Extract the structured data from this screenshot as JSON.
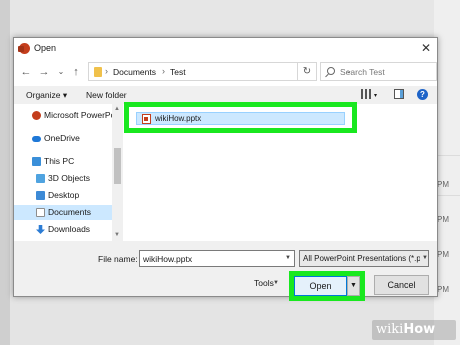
{
  "background": {
    "times": [
      "PM",
      "PM",
      "PM",
      "PM"
    ],
    "watermark": {
      "wiki": "wiki",
      "how": "How"
    }
  },
  "dialog": {
    "title": "Open",
    "close_label": "✕"
  },
  "navigation": {
    "back": "←",
    "forward": "→",
    "dropdown": "⌄",
    "up": "↑",
    "path": [
      "Documents",
      "Test"
    ],
    "separator": "›",
    "refresh": "↻",
    "search_placeholder": "Search Test"
  },
  "command_bar": {
    "organize": "Organize ▾",
    "new_folder": "New folder",
    "view_dd": "▾",
    "help": "?"
  },
  "sidebar": {
    "items": [
      {
        "label": "Microsoft PowerPo",
        "color": "#c43e1c"
      },
      {
        "label": "OneDrive",
        "color": "#1e78d7"
      },
      {
        "label": "This PC",
        "color": "#3a8fd9"
      },
      {
        "label": "3D Objects",
        "color": "#4fa3e0"
      },
      {
        "label": "Desktop",
        "color": "#3d8ad6"
      },
      {
        "label": "Documents",
        "color": "#8d8d8d",
        "selected": true
      },
      {
        "label": "Downloads",
        "color": "#2c7cd4"
      }
    ]
  },
  "files": [
    {
      "name": "wikiHow.pptx",
      "selected": true
    }
  ],
  "bottom": {
    "file_name_label": "File name:",
    "file_name_value": "wikiHow.pptx",
    "filter": "All PowerPoint Presentations (*.p",
    "tools": "Tools",
    "open": "Open",
    "cancel": "Cancel"
  },
  "colors": {
    "highlight": "#19e81f",
    "selection": "#cce8ff",
    "accent": "#0078d7"
  }
}
